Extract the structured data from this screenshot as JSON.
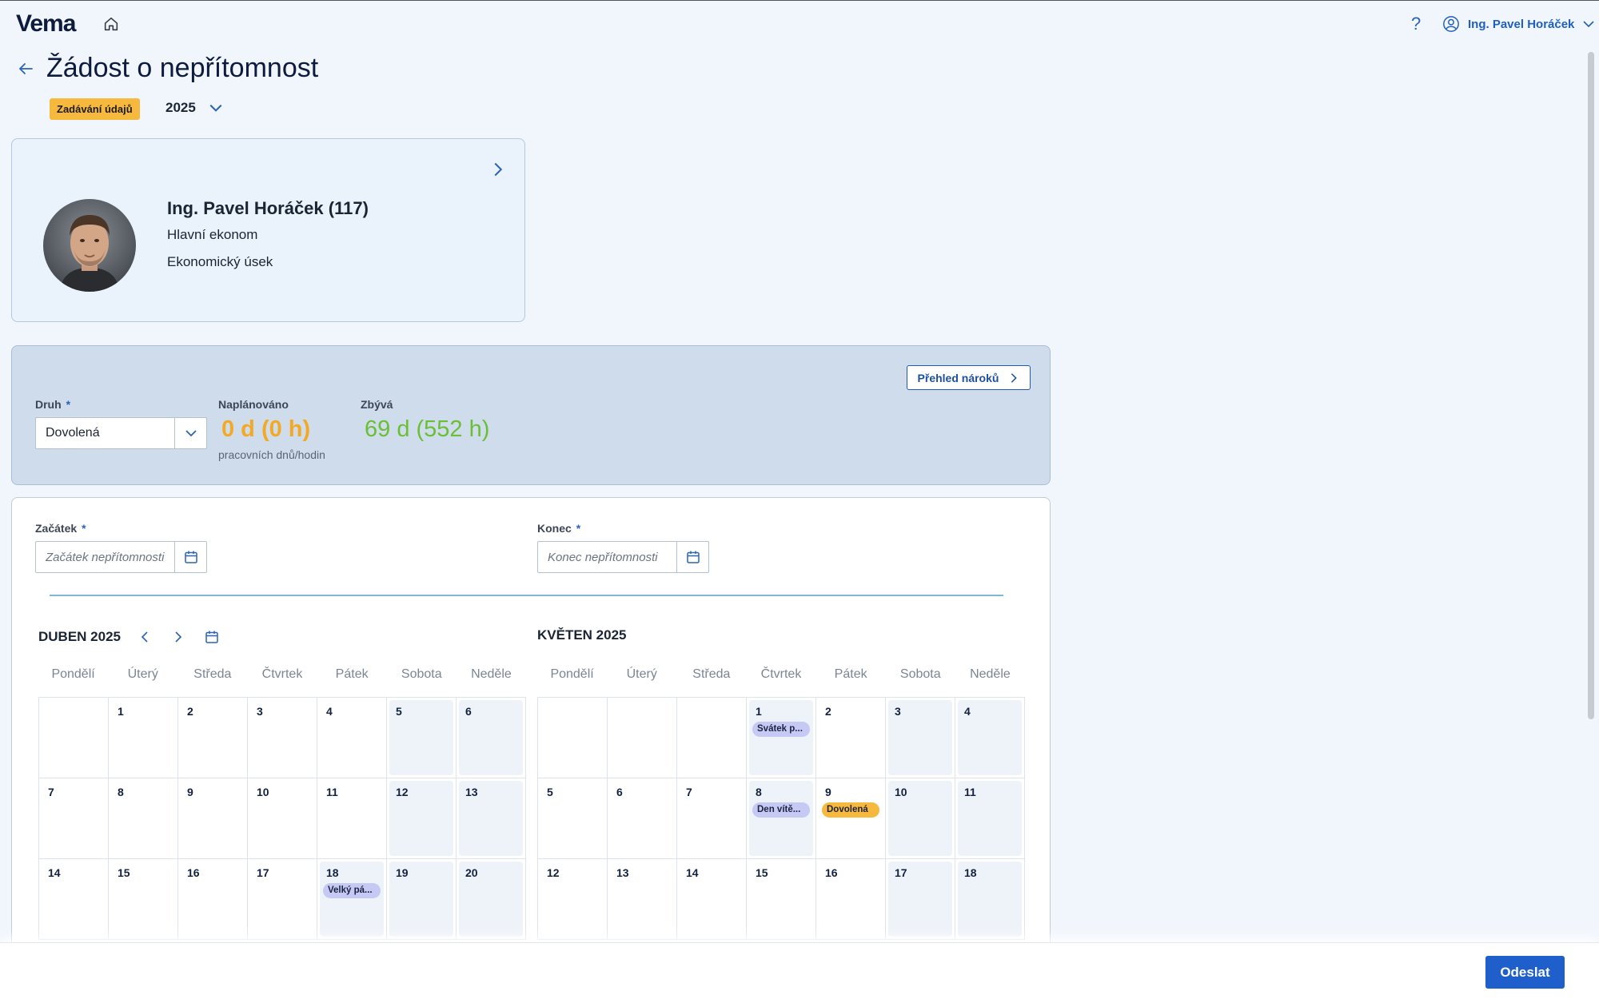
{
  "header": {
    "logo": "Vema",
    "user_name": "Ing. Pavel Horáček",
    "help_symbol": "?"
  },
  "page": {
    "title": "Žádost o nepřítomnost",
    "status_badge": "Zadávání údajů",
    "year": "2025"
  },
  "employee": {
    "name": "Ing. Pavel Horáček (117)",
    "position": "Hlavní ekonom",
    "department": "Ekonomický úsek"
  },
  "quota": {
    "overview_button": "Přehled nároků",
    "type_label": "Druh",
    "type_value": "Dovolená",
    "required_mark": "*",
    "planned_label": "Naplánováno",
    "planned_value": "0 d (0 h)",
    "planned_sub": "pracovních dnů/hodin",
    "remaining_label": "Zbývá",
    "remaining_value": "69 d (552 h)"
  },
  "form": {
    "start_label": "Začátek",
    "start_placeholder": "Začátek nepřítomnosti",
    "end_label": "Konec",
    "end_placeholder": "Konec nepřítomnosti"
  },
  "calendar": {
    "weekdays": [
      "Pondělí",
      "Úterý",
      "Středa",
      "Čtvrtek",
      "Pátek",
      "Sobota",
      "Neděle"
    ],
    "months": [
      {
        "title": "DUBEN 2025",
        "weeks": [
          [
            "",
            "1",
            "2",
            "3",
            "4",
            "5",
            "6"
          ],
          [
            "7",
            "8",
            "9",
            "10",
            "11",
            "12",
            "13"
          ],
          [
            "14",
            "15",
            "16",
            "17",
            "18",
            "19",
            "20"
          ]
        ],
        "events": {
          "2.4": "Velký pá..."
        }
      },
      {
        "title": "KVĚTEN 2025",
        "weeks": [
          [
            "",
            "",
            "",
            "1",
            "2",
            "3",
            "4"
          ],
          [
            "5",
            "6",
            "7",
            "8",
            "9",
            "10",
            "11"
          ],
          [
            "12",
            "13",
            "14",
            "15",
            "16",
            "17",
            "18"
          ]
        ],
        "events": {
          "0.3": "Svátek p...",
          "1.3": "Den vítě...",
          "1.4": "Dovolená"
        }
      }
    ]
  },
  "footer": {
    "submit_label": "Odeslat"
  },
  "colors": {
    "accent": "#1e5fcc",
    "badge": "#f7b93d",
    "planned": "#f3a925",
    "remaining": "#6abf34",
    "holiday_tag": "#c5c9f4"
  }
}
